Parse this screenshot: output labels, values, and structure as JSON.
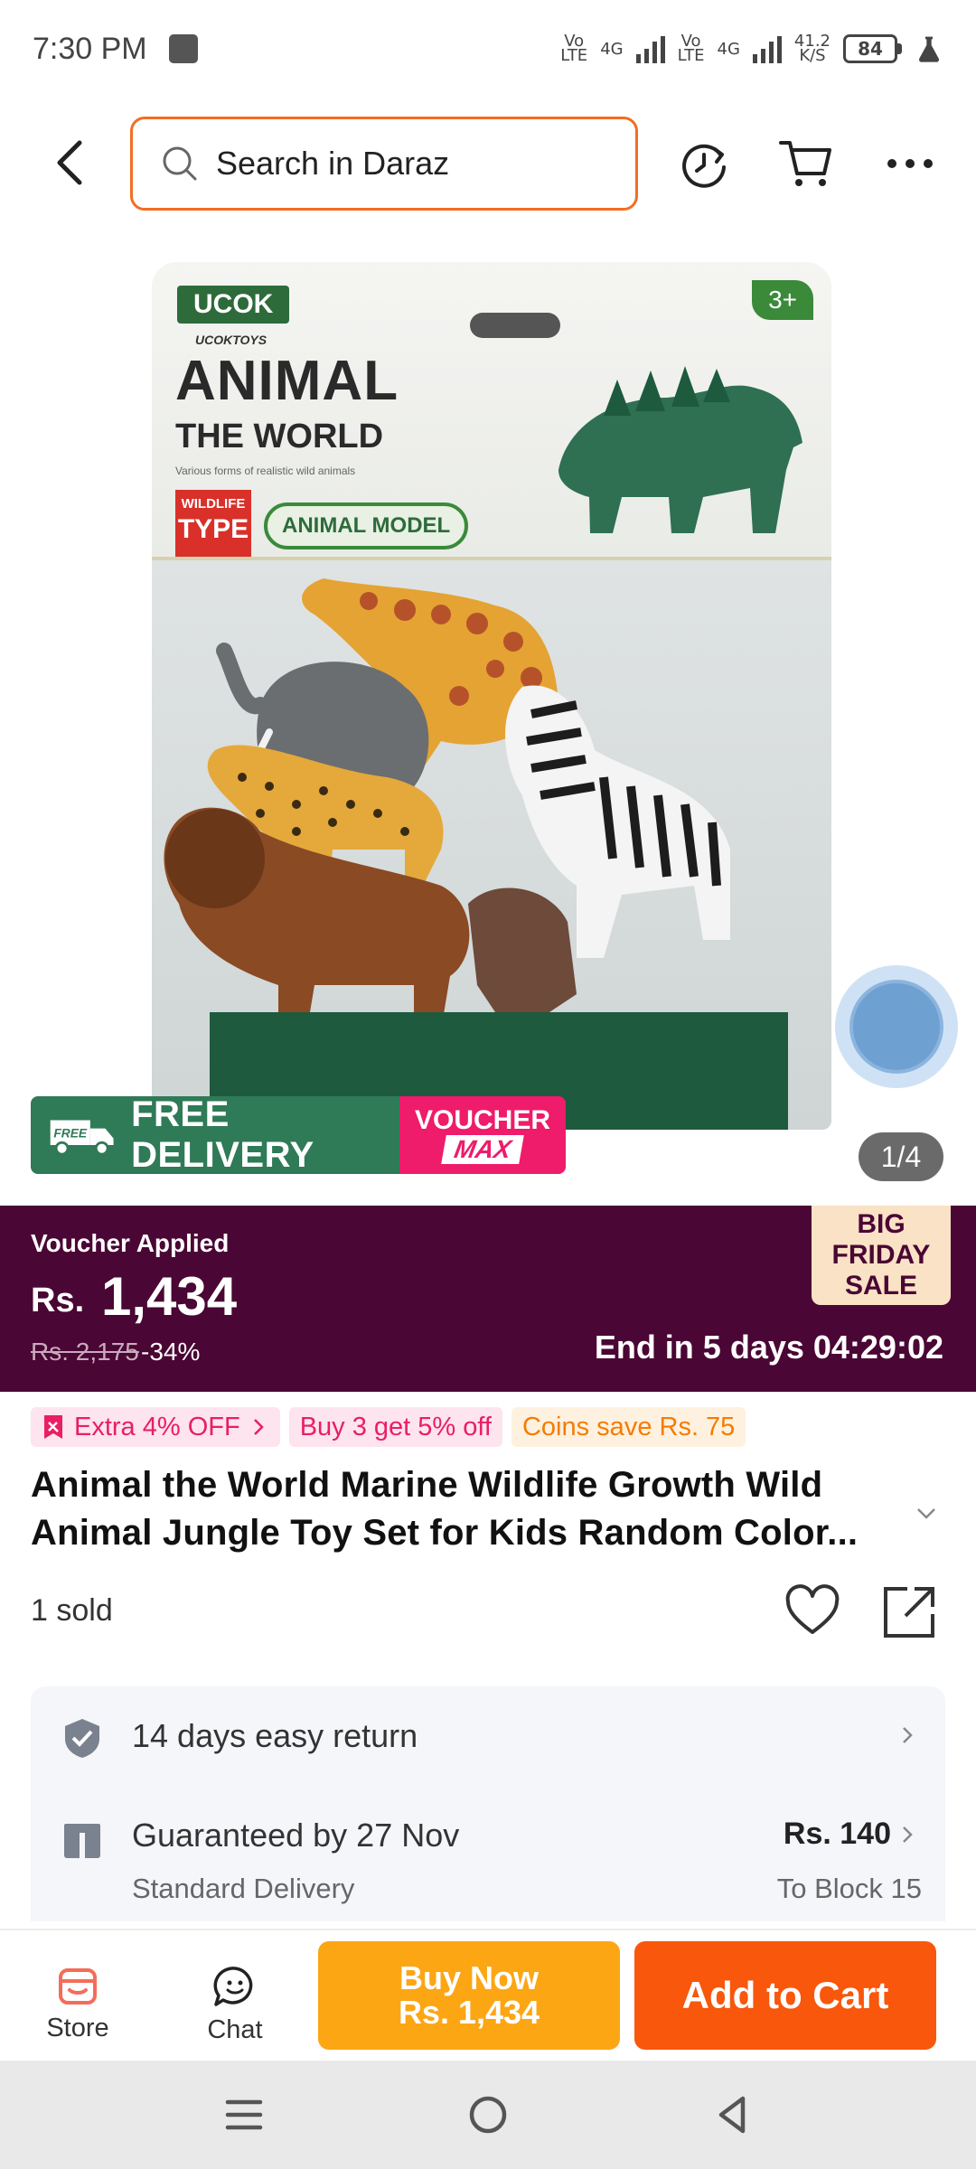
{
  "status_bar": {
    "time": "7:30 PM",
    "net1": "Vo\nLTE",
    "net2": "4G",
    "net3": "Vo\nLTE",
    "net4": "4G",
    "speed": "41.2\nK/S",
    "battery": "84"
  },
  "header": {
    "search_placeholder": "Search in Daraz",
    "icons": [
      "back-icon",
      "search-icon",
      "history-icon",
      "cart-icon",
      "more-icon"
    ]
  },
  "product_image": {
    "brand": "UCOK",
    "brand_sub": "UCOKTOYS",
    "age": "3+",
    "title_line1": "ANIMAL",
    "title_line2": "THE WORLD",
    "tagline": "Various forms of realistic wild animals",
    "type_top": "WILDLIFE",
    "type_bottom": "TYPE",
    "model_label": "ANIMAL MODEL",
    "pager": "1/4"
  },
  "promo_banner": {
    "free_badge": "FREE",
    "free_delivery": "FREE DELIVERY",
    "voucher_1": "VOUCHER",
    "voucher_2": "MAX"
  },
  "price": {
    "voucher_applied": "Voucher Applied",
    "currency": "Rs.",
    "current": "1,434",
    "original": "Rs. 2,175",
    "discount": "-34%",
    "ends": "End in 5 days 04:29:02",
    "sale_badge": "BIG FRIDAY SALE",
    "sale_color": "#4a0634"
  },
  "tags": {
    "extra": "Extra 4% OFF",
    "bundle": "Buy 3 get 5% off",
    "coins": "Coins save Rs. 75"
  },
  "product": {
    "title": "Animal the World Marine Wildlife Growth Wild Animal Jungle Toy Set for Kids Random Color...",
    "sold": "1 sold"
  },
  "services": {
    "return": "14 days easy return",
    "guarantee": "Guaranteed by 27 Nov",
    "delivery_type": "Standard Delivery",
    "delivery_price": "Rs. 140",
    "delivery_to": "To Block 15"
  },
  "bottom_bar": {
    "store": "Store",
    "chat": "Chat",
    "buy_now_1": "Buy Now",
    "buy_now_2": "Rs. 1,434",
    "add_to_cart": "Add to Cart",
    "buy_color": "#fca614",
    "cart_color": "#f8570c"
  }
}
